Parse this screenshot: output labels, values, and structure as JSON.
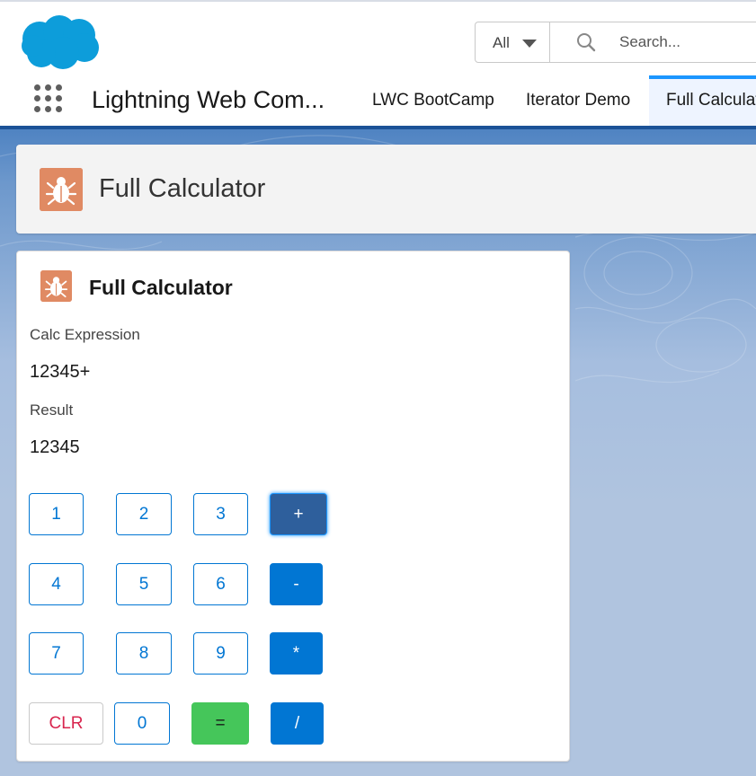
{
  "header": {
    "search_scope": "All",
    "search_placeholder": "Search..."
  },
  "nav": {
    "app_name": "Lightning Web Com...",
    "tabs": [
      {
        "label": "LWC BootCamp"
      },
      {
        "label": "Iterator Demo"
      },
      {
        "label": "Full Calculator"
      }
    ]
  },
  "page": {
    "title": "Full Calculator"
  },
  "card": {
    "title": "Full Calculator",
    "expression_label": "Calc Expression",
    "expression_value": "12345+",
    "result_label": "Result",
    "result_value": "12345"
  },
  "keypad": {
    "row1": [
      "1",
      "2",
      "3",
      "+"
    ],
    "row2": [
      "4",
      "5",
      "6",
      "-"
    ],
    "row3": [
      "7",
      "8",
      "9",
      "*"
    ],
    "row4": [
      "CLR",
      "0",
      "=",
      "/"
    ]
  },
  "colors": {
    "brand_blue": "#0176d3",
    "app_icon": "#e08a63",
    "clear_text": "#d8254e",
    "equals_green": "#45c65a"
  },
  "icons": [
    "salesforce-cloud-logo",
    "chevron-down-icon",
    "search-icon",
    "app-launcher-icon",
    "bug-icon"
  ]
}
